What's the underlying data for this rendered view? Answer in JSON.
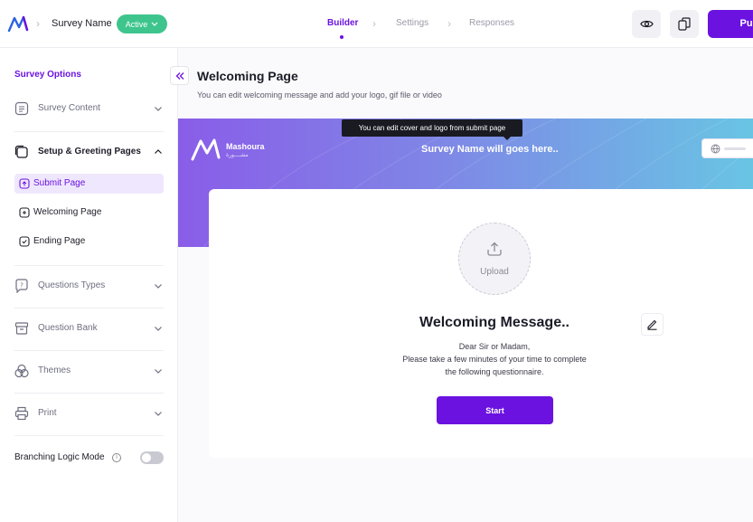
{
  "header": {
    "survey_name": "Survey Name",
    "status": "Active",
    "steps": [
      "Builder",
      "Settings",
      "Responses"
    ],
    "active_step": "Builder",
    "publish_label": "Publi",
    "colors": {
      "accent": "#6b12e0",
      "status": "#3ec58d"
    }
  },
  "sidebar": {
    "title": "Survey Options",
    "items": [
      {
        "label": "Survey Content",
        "icon": "list-icon"
      },
      {
        "label": "Setup & Greeting Pages",
        "icon": "pages-icon",
        "expanded": true
      },
      {
        "label": "Questions Types",
        "icon": "question-icon"
      },
      {
        "label": "Question Bank",
        "icon": "archive-icon"
      },
      {
        "label": "Themes",
        "icon": "circles-icon"
      },
      {
        "label": "Print",
        "icon": "printer-icon"
      }
    ],
    "sub_items": [
      {
        "label": "Submit Page",
        "active": true
      },
      {
        "label": "Welcoming Page"
      },
      {
        "label": "Ending Page"
      }
    ],
    "branching_label": "Branching Logic Mode",
    "branching_enabled": false
  },
  "main": {
    "title": "Welcoming Page",
    "subtitle": "You can edit welcoming message and add your logo, gif file or video",
    "tooltip": "You can edit cover and logo from submit page",
    "brand_name": "Mashoura",
    "brand_ar": "مشــــورة",
    "cover_title": "Survey Name will goes here..",
    "upload_label": "Upload",
    "welcome_title": "Welcoming Message..",
    "welcome_body": [
      "Dear Sir or Madam,",
      "Please take a few minutes of your time to complete",
      "the following questionnaire."
    ],
    "start_label": "Start"
  }
}
